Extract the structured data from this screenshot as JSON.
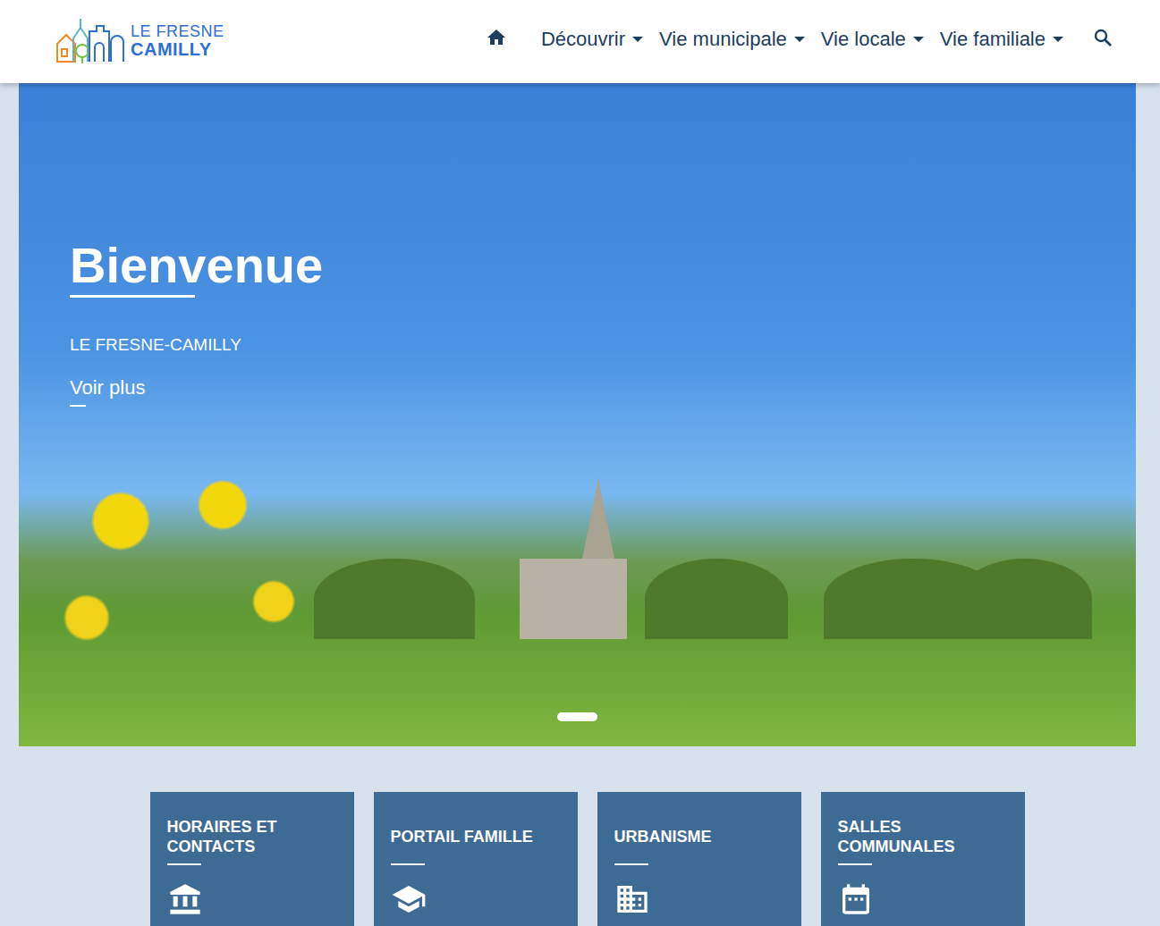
{
  "logo": {
    "line1": "LE FRESNE",
    "line2": "CAMILLY"
  },
  "nav": [
    {
      "label": "Découvrir",
      "dropdown": true
    },
    {
      "label": "Vie municipale",
      "dropdown": true
    },
    {
      "label": "Vie locale",
      "dropdown": true
    },
    {
      "label": "Vie familiale",
      "dropdown": true
    }
  ],
  "hero": {
    "title": "Bienvenue",
    "subtitle": "LE FRESNE-CAMILLY",
    "link": "Voir plus",
    "slides": [
      {
        "selected": true
      }
    ]
  },
  "cards": [
    {
      "title": "HORAIRES ET CONTACTS",
      "kind": "bank"
    },
    {
      "title": "PORTAIL FAMILLE",
      "kind": "school"
    },
    {
      "title": "URBANISME",
      "kind": "building"
    },
    {
      "title": "SALLES COMMUNALES",
      "kind": "calendar"
    }
  ]
}
